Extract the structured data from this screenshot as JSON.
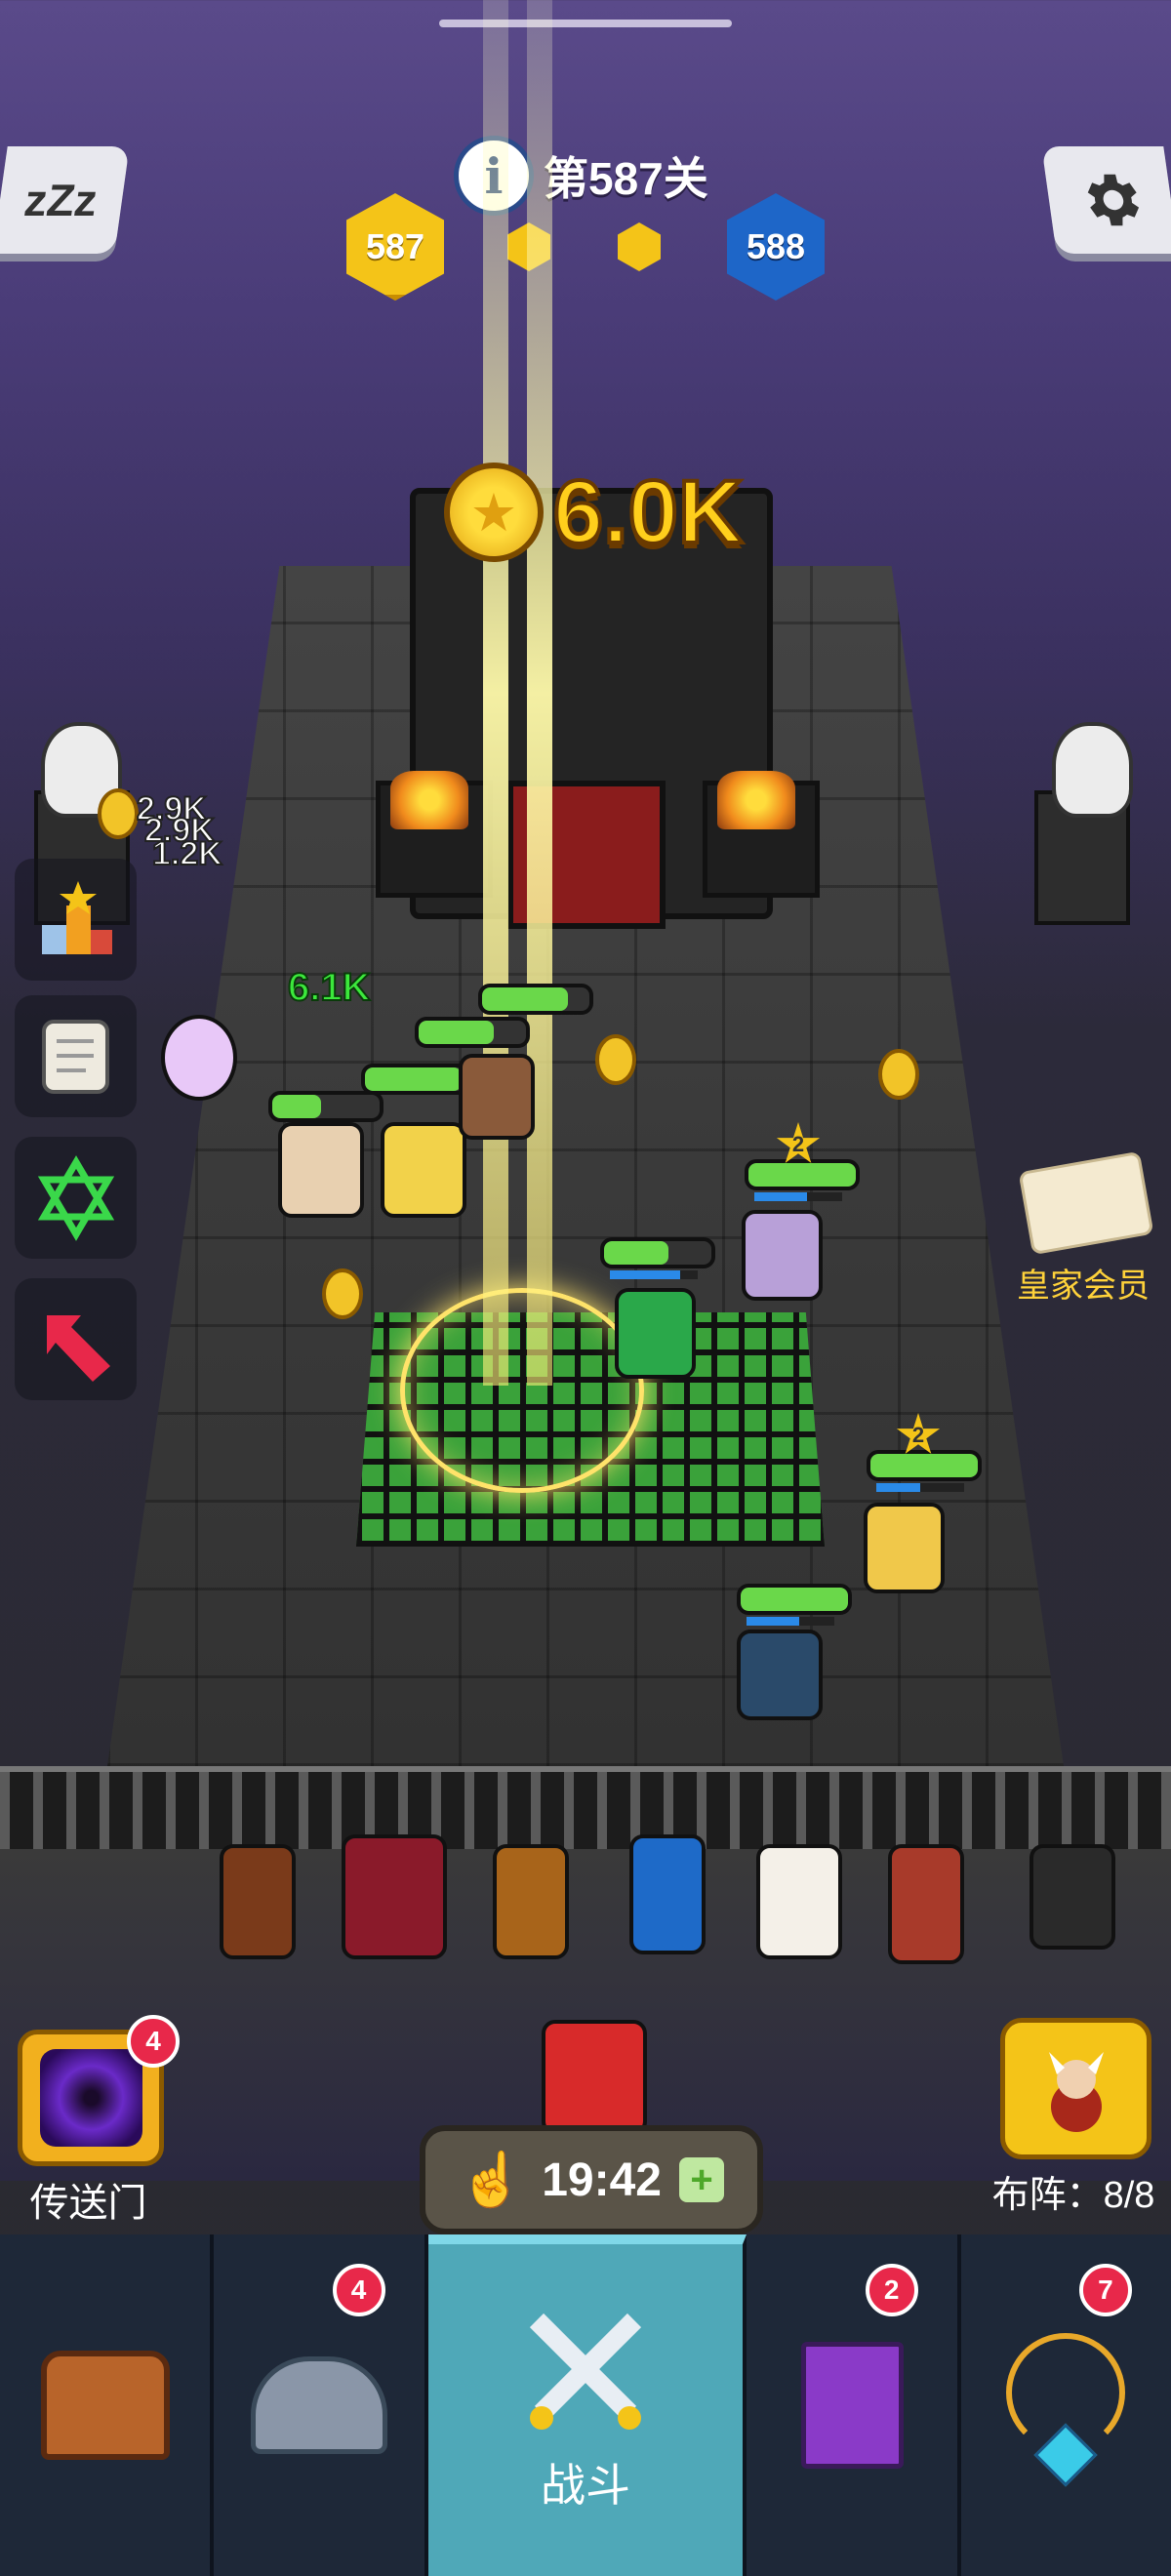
{
  "top": {
    "level_prefix": "第",
    "level_number": "587",
    "level_suffix": "关",
    "current_level_badge": "587",
    "next_level_badge": "588"
  },
  "reward": {
    "amount": "6.0K"
  },
  "floating_numbers": {
    "gold_a": "2.9K",
    "gold_b": "2.9K",
    "gold_c": "1.2K",
    "damage_green": "6.1K"
  },
  "unit_stars": {
    "star_1": "2",
    "star_2": "2"
  },
  "royal": {
    "label": "皇家会员"
  },
  "portal": {
    "label": "传送门",
    "badge": "4"
  },
  "timer": {
    "value": "19:42",
    "plus": "+"
  },
  "formation": {
    "label": "布阵：8/8"
  },
  "nav": {
    "items": [
      {
        "icon": "treasure-chest-icon",
        "label": "",
        "badge": ""
      },
      {
        "icon": "winged-helmet-icon",
        "label": "",
        "badge": "4"
      },
      {
        "icon": "crossed-swords-icon",
        "label": "战斗",
        "badge": ""
      },
      {
        "icon": "spellbook-icon",
        "label": "",
        "badge": "2"
      },
      {
        "icon": "amulet-icon",
        "label": "",
        "badge": "7"
      }
    ]
  },
  "icons": {
    "sleep": "sleep-zzz-icon",
    "settings": "gear-icon",
    "info": "info-icon",
    "side_menu": [
      "trophy-icon",
      "scroll-map-icon",
      "hexagram-icon",
      "red-arrow-icon"
    ]
  },
  "colors": {
    "gold": "#ffcf1c",
    "current_hex": "#f4c418",
    "next_hex": "#1e66c8",
    "nav_active": "#4fa8b8",
    "badge_red": "#e8284a"
  }
}
